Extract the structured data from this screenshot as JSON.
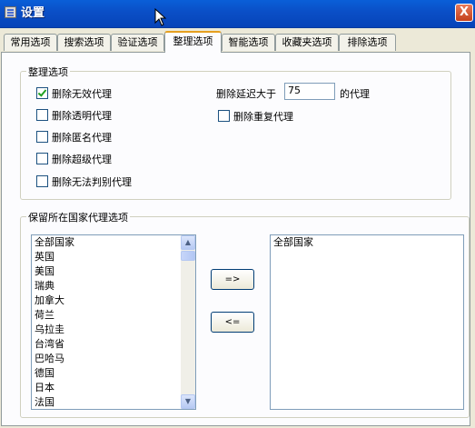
{
  "window": {
    "title": "设置",
    "close_label": "X"
  },
  "tabs": [
    {
      "label": "常用选项"
    },
    {
      "label": "搜索选项"
    },
    {
      "label": "验证选项"
    },
    {
      "label": "整理选项",
      "active": true
    },
    {
      "label": "智能选项"
    },
    {
      "label": "收藏夹选项"
    },
    {
      "label": "排除选项"
    }
  ],
  "cleanup": {
    "group_label": "整理选项",
    "options": [
      {
        "label": "删除无效代理",
        "checked": true
      },
      {
        "label": "删除透明代理",
        "checked": false
      },
      {
        "label": "删除匿名代理",
        "checked": false
      },
      {
        "label": "删除超级代理",
        "checked": false
      },
      {
        "label": "删除无法判别代理",
        "checked": false
      }
    ],
    "delay_prefix": "删除延迟大于",
    "delay_value": "75",
    "delay_suffix": "的代理",
    "duplicate": {
      "label": "删除重复代理",
      "checked": false
    }
  },
  "countries": {
    "group_label": "保留所在国家代理选项",
    "available": [
      "全部国家",
      "英国",
      "美国",
      "瑞典",
      "加拿大",
      "荷兰",
      "乌拉圭",
      "台湾省",
      "巴哈马",
      "德国",
      "日本",
      "法国"
    ],
    "selected": [
      "全部国家"
    ],
    "add_label": "=>",
    "remove_label": "<="
  }
}
